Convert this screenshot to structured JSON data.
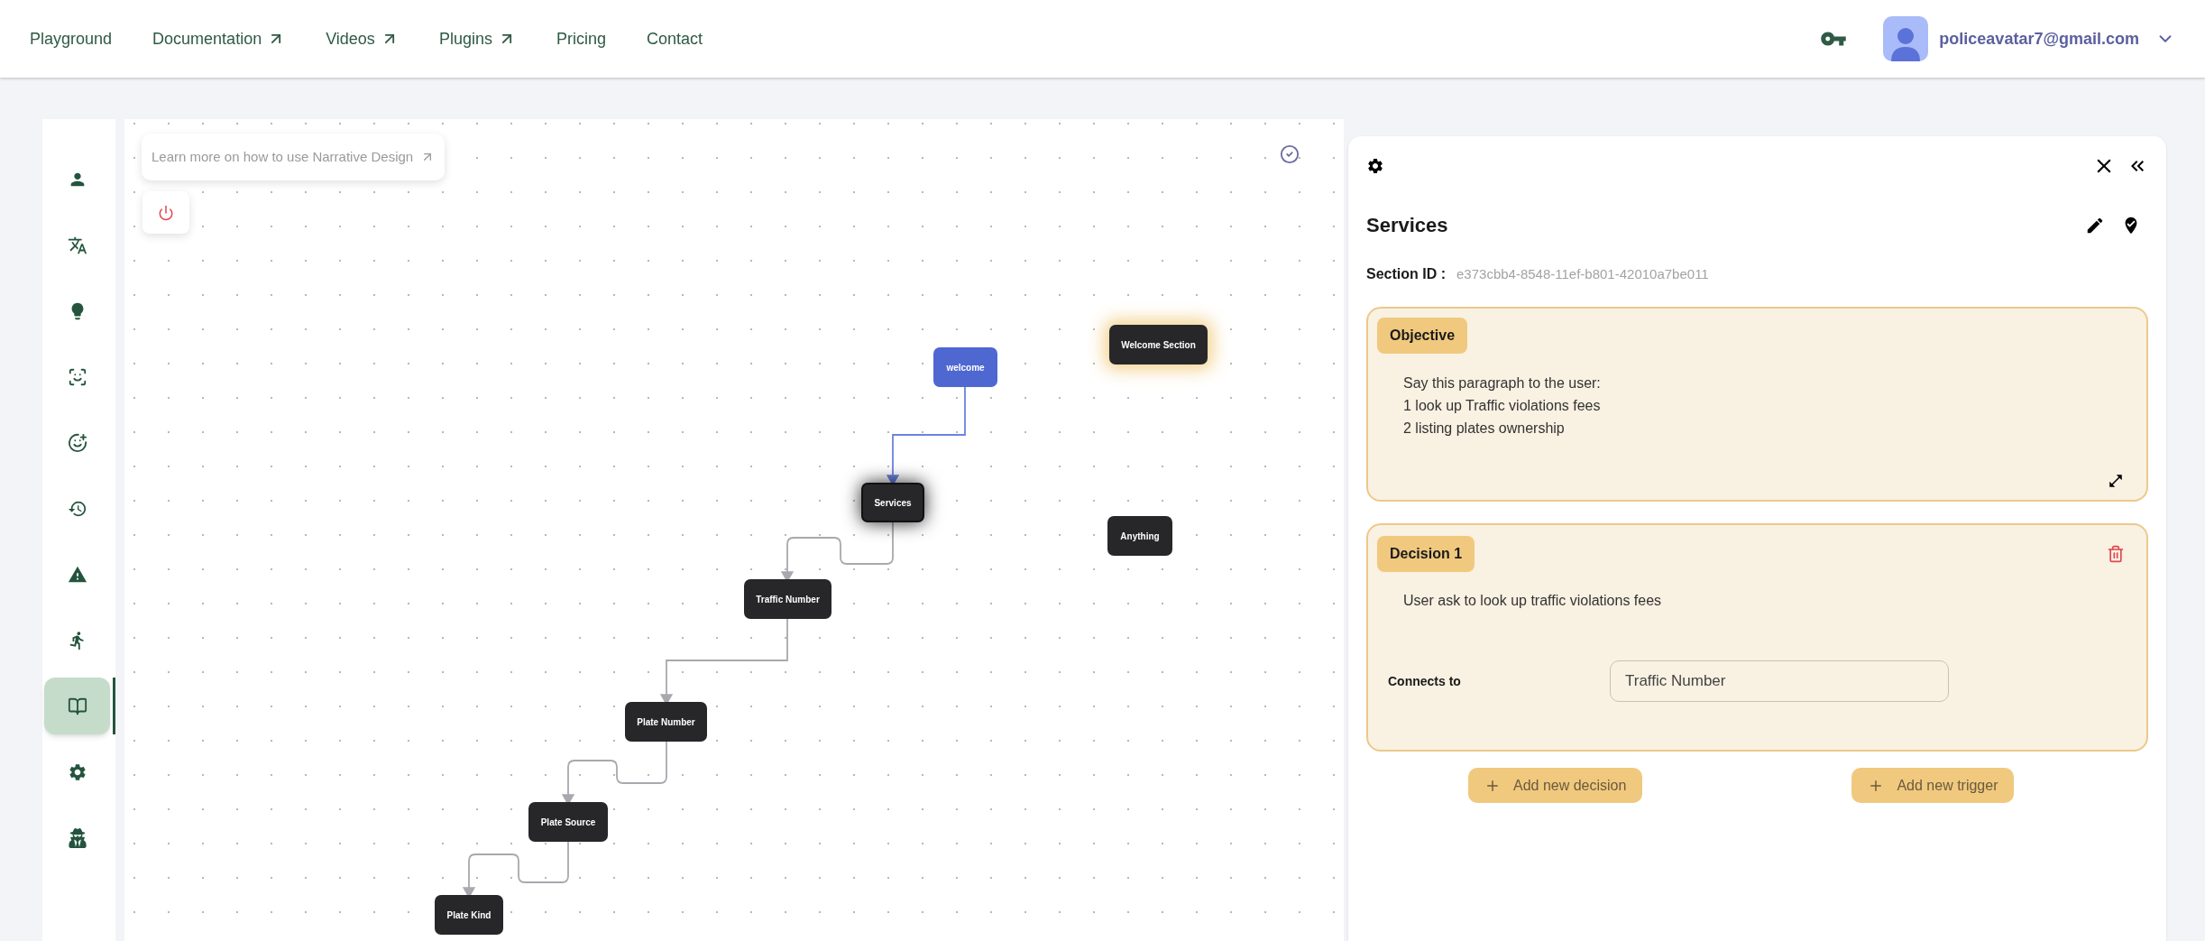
{
  "nav": {
    "items": [
      {
        "label": "Playground",
        "external": false
      },
      {
        "label": "Documentation",
        "external": true
      },
      {
        "label": "Videos",
        "external": true
      },
      {
        "label": "Plugins",
        "external": true
      },
      {
        "label": "Pricing",
        "external": false
      },
      {
        "label": "Contact",
        "external": false
      }
    ],
    "account": {
      "email": "policeavatar7@gmail.com"
    }
  },
  "sidebar": {
    "items": [
      {
        "selected": false
      },
      {
        "selected": false
      },
      {
        "selected": false
      },
      {
        "selected": false
      },
      {
        "selected": false
      },
      {
        "selected": false
      },
      {
        "selected": false
      },
      {
        "selected": false
      },
      {
        "selected": true
      },
      {
        "selected": false
      },
      {
        "selected": false
      }
    ]
  },
  "canvas": {
    "help_link": "Learn more on how to use Narrative Design",
    "nodes": [
      {
        "label": "welcome",
        "kind": "start",
        "selected": false,
        "highlighted": false
      },
      {
        "label": "Welcome Section",
        "kind": "section",
        "selected": false,
        "highlighted": true
      },
      {
        "label": "Services",
        "kind": "section",
        "selected": true,
        "highlighted": false
      },
      {
        "label": "Anything",
        "kind": "section",
        "selected": false,
        "highlighted": false
      },
      {
        "label": "Traffic Number",
        "kind": "section",
        "selected": false,
        "highlighted": false
      },
      {
        "label": "Plate Number",
        "kind": "section",
        "selected": false,
        "highlighted": false
      },
      {
        "label": "Plate Source",
        "kind": "section",
        "selected": false,
        "highlighted": false
      },
      {
        "label": "Plate Kind",
        "kind": "section",
        "selected": false,
        "highlighted": false
      }
    ]
  },
  "panel": {
    "title": "Services",
    "section_id_label": "Section ID :",
    "section_id": "e373cbb4-8548-11ef-b801-42010a7be011",
    "objective": {
      "label": "Objective",
      "lines": [
        "Say this paragraph to the user:",
        "1 look up Traffic violations fees",
        "2 listing plates ownership"
      ]
    },
    "decisions": [
      {
        "label": "Decision 1",
        "text": "User ask to look up traffic violations fees",
        "connects_label": "Connects to",
        "connects_value": "Traffic Number"
      }
    ],
    "buttons": [
      "Add new decision",
      "Add new trigger"
    ]
  }
}
